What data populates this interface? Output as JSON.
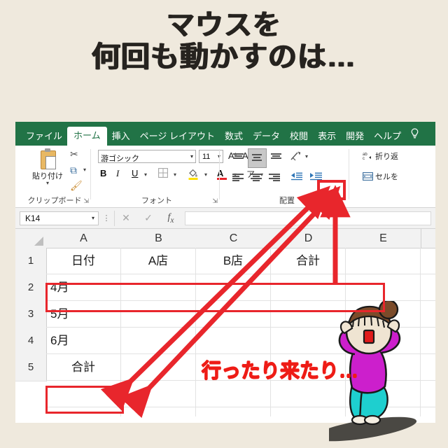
{
  "background_color": "#EFE9DD",
  "title": {
    "line1": "マウスを",
    "line2": "何回も動かすのは…",
    "color": "#26231F"
  },
  "excel": {
    "ribbon_tabs": [
      {
        "label": "ファイル",
        "active": false
      },
      {
        "label": "ホーム",
        "active": true
      },
      {
        "label": "挿入",
        "active": false
      },
      {
        "label": "ページ レイアウト",
        "active": false
      },
      {
        "label": "数式",
        "active": false
      },
      {
        "label": "データ",
        "active": false
      },
      {
        "label": "校閲",
        "active": false
      },
      {
        "label": "表示",
        "active": false
      },
      {
        "label": "開発",
        "active": false
      },
      {
        "label": "ヘルプ",
        "active": false
      }
    ],
    "ribbon_accent_color": "#217346",
    "tellme_icon": "lightbulb-icon",
    "groups": {
      "clipboard": {
        "label": "クリップボード",
        "paste_label": "貼り付け",
        "cut_icon": "scissors-icon",
        "copy_icon": "copy-icon",
        "format_painter_icon": "paintbrush-icon",
        "dialog_launcher_icon": "dialog-launcher-icon"
      },
      "font": {
        "label": "フォント",
        "font_name": "游ゴシック",
        "font_size": "11",
        "bold_label": "B",
        "italic_label": "I",
        "underline_label": "U",
        "grow_label": "A",
        "shrink_label": "A",
        "border_icon": "borders-icon",
        "fill_icon": "fill-color-icon",
        "fill_color": "#FFE000",
        "font_color_icon": "font-color-icon",
        "font_color": "#E8262C",
        "phonetic_label": "ア",
        "dialog_launcher_icon": "dialog-launcher-icon"
      },
      "alignment": {
        "label": "配置",
        "wrap_text_label": "折り返",
        "merge_label": "セルを",
        "orientation_icon": "text-orientation-icon",
        "decrease_indent_icon": "decrease-indent-icon",
        "increase_indent_icon": "increase-indent-icon",
        "highlighted_button": "center-align-horizontal",
        "selected_button": "center-align-vertical",
        "dialog_launcher_icon": "dialog-launcher-icon"
      }
    },
    "formula_bar": {
      "name_box_value": "K14",
      "cancel_icon": "close-icon",
      "enter_icon": "check-icon",
      "function_icon": "fx-icon",
      "formula_value": ""
    },
    "grid": {
      "column_headers": [
        "A",
        "B",
        "C",
        "D",
        "E"
      ],
      "row_headers": [
        "1",
        "2",
        "3",
        "4",
        "5"
      ],
      "cells": [
        {
          "ref": "A1",
          "value": "日付",
          "row": 0,
          "col": 0,
          "align": "center"
        },
        {
          "ref": "B1",
          "value": "A店",
          "row": 0,
          "col": 1,
          "align": "center"
        },
        {
          "ref": "C1",
          "value": "B店",
          "row": 0,
          "col": 2,
          "align": "center"
        },
        {
          "ref": "D1",
          "value": "合計",
          "row": 0,
          "col": 3,
          "align": "center"
        },
        {
          "ref": "A2",
          "value": "4月",
          "row": 1,
          "col": 0,
          "align": "left"
        },
        {
          "ref": "A3",
          "value": "5月",
          "row": 2,
          "col": 0,
          "align": "left"
        },
        {
          "ref": "A4",
          "value": "6月",
          "row": 3,
          "col": 0,
          "align": "left"
        },
        {
          "ref": "A5",
          "value": "合計",
          "row": 4,
          "col": 0,
          "align": "center"
        }
      ]
    }
  },
  "annotations": {
    "text": "行ったり来たり…",
    "text_color": "#EE1C16",
    "highlight_color": "#E8262C",
    "boxes": [
      "center-align-button",
      "row-1-header-range",
      "cell-a5"
    ],
    "arrows": [
      "double-headed-diagonal-a5-to-align-button",
      "vertical-d1-to-align-button"
    ]
  },
  "character": {
    "name": "frustrated-woman-illustration",
    "shirt_color": "#CC1FCC",
    "pants_color": "#1ECFCF",
    "hair_color": "#7B4B2A",
    "skin_color": "#EFE4D2",
    "shadow_color": "#4A4843"
  }
}
